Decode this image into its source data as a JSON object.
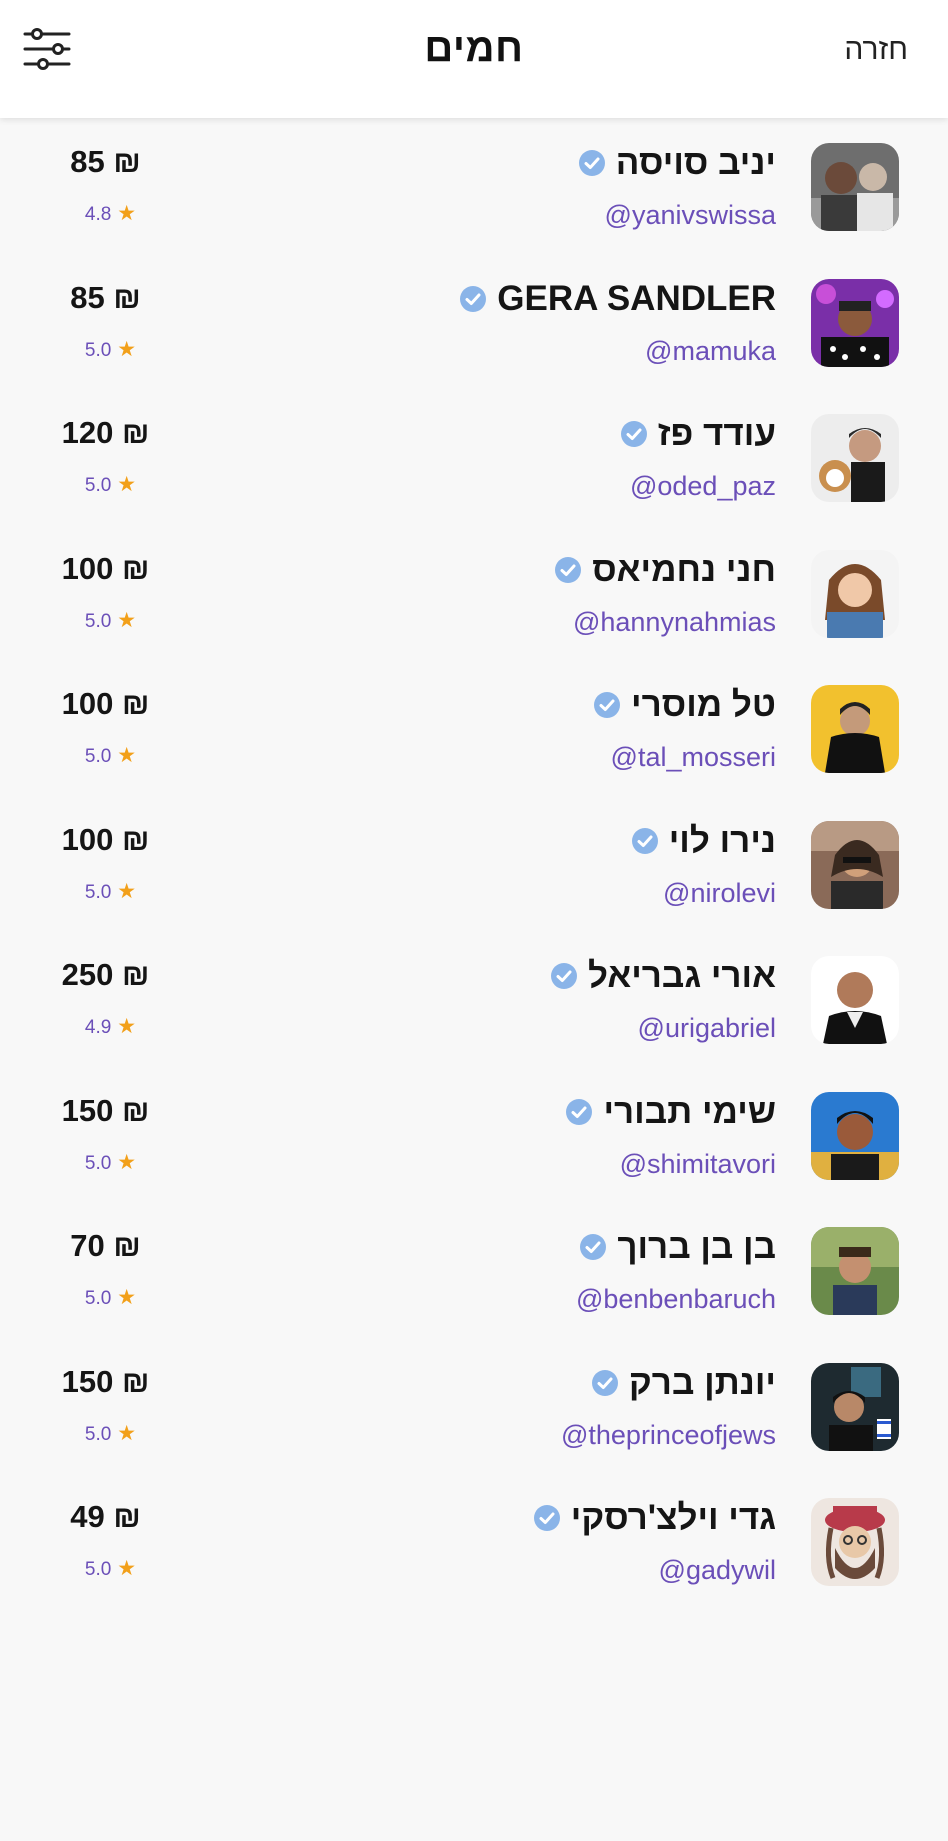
{
  "header": {
    "title": "חמים",
    "back_label": "חזרה"
  },
  "colors": {
    "handle": "#6b4fb8",
    "star": "#f2a01a",
    "verified": "#8ab4e8"
  },
  "items": [
    {
      "name": "יניב סויסה",
      "handle": "@yanivswissa",
      "price": "85 ₪",
      "rating": "4.8"
    },
    {
      "name": "GERA SANDLER",
      "handle": "@mamuka",
      "price": "85 ₪",
      "rating": "5.0"
    },
    {
      "name": "עודד פז",
      "handle": "@oded_paz",
      "price": "120 ₪",
      "rating": "5.0"
    },
    {
      "name": "חני נחמיאס",
      "handle": "@hannynahmias",
      "price": "100 ₪",
      "rating": "5.0"
    },
    {
      "name": "טל מוסרי",
      "handle": "@tal_mosseri",
      "price": "100 ₪",
      "rating": "5.0"
    },
    {
      "name": "נירו לוי",
      "handle": "@nirolevi",
      "price": "100 ₪",
      "rating": "5.0"
    },
    {
      "name": "אורי  גבריאל",
      "handle": "@urigabriel",
      "price": "250 ₪",
      "rating": "4.9"
    },
    {
      "name": "שימי תבורי",
      "handle": "@shimitavori",
      "price": "150 ₪",
      "rating": "5.0"
    },
    {
      "name": "בן בן ברוך",
      "handle": "@benbenbaruch",
      "price": "70 ₪",
      "rating": "5.0"
    },
    {
      "name": "יונתן ברק",
      "handle": "@theprinceofjews",
      "price": "150 ₪",
      "rating": "5.0"
    },
    {
      "name": "גדי וילצ'רסקי",
      "handle": "@gadywil",
      "price": "49 ₪",
      "rating": "5.0"
    }
  ]
}
